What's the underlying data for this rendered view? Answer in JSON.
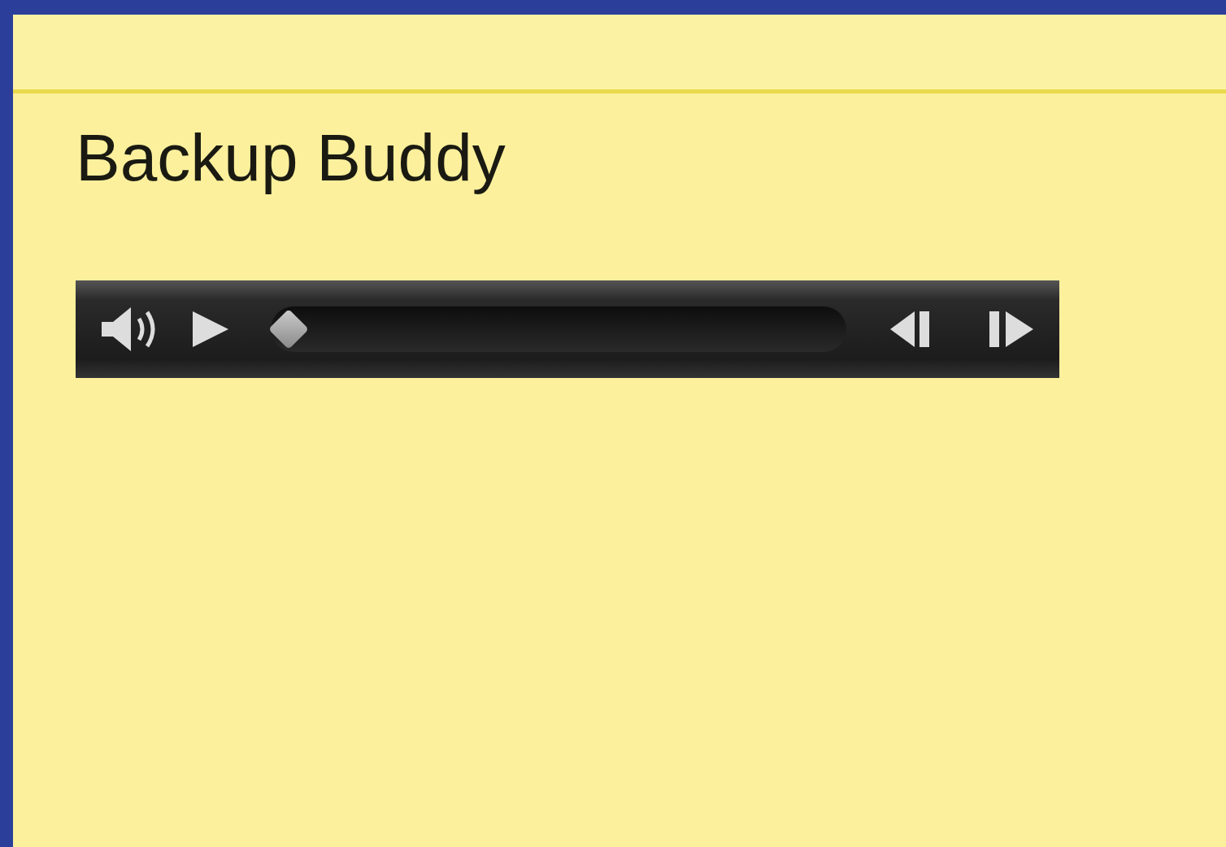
{
  "title": "Backup Buddy",
  "player": {
    "level": 0
  }
}
